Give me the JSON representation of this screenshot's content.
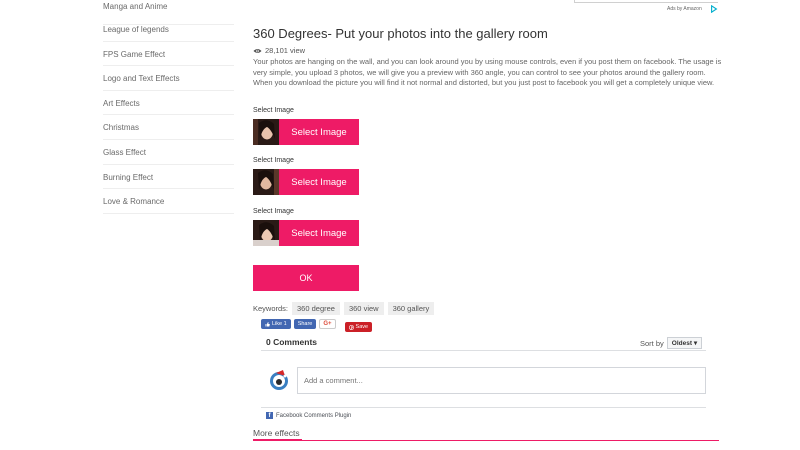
{
  "sidebar": {
    "items": [
      {
        "label": "Manga and Anime"
      },
      {
        "label": "League of legends"
      },
      {
        "label": "FPS Game Effect"
      },
      {
        "label": "Logo and Text Effects"
      },
      {
        "label": "Art Effects"
      },
      {
        "label": "Christmas"
      },
      {
        "label": "Glass Effect"
      },
      {
        "label": "Burning Effect"
      },
      {
        "label": "Love & Romance"
      }
    ]
  },
  "ads": {
    "label": "Ads by Amazon"
  },
  "main": {
    "title": "360 Degrees- Put your photos into the gallery room",
    "views": "28,101 view",
    "description": "Your photos are hanging on the wall, and you can look around you by using mouse controls, even if you post them on facebook. The usage is very simple, you upload 3 photos, we will give you a preview with 360 angle, you can control to see your photos around the gallery room. When you download the picture you will find it not normal and distorted, but you just post to facebook you will get a completely unique view.",
    "select_label": "Select Image",
    "select_button": "Select Image",
    "ok_button": "OK",
    "keywords_label": "Keywords:",
    "keywords": [
      "360 degree",
      "360 view",
      "360 gallery"
    ]
  },
  "social": {
    "like": "Like 1",
    "share": "Share",
    "gplus": "G+",
    "save": "Save"
  },
  "comments": {
    "count": "0 Comments",
    "sort_label": "Sort by",
    "sort_value": "Oldest",
    "placeholder": "Add a comment...",
    "plugin": "Facebook Comments Plugin"
  },
  "more": {
    "label": "More effects"
  },
  "colors": {
    "accent": "#ee1b66",
    "facebook": "#4267b2",
    "pinterest": "#cb2027"
  }
}
